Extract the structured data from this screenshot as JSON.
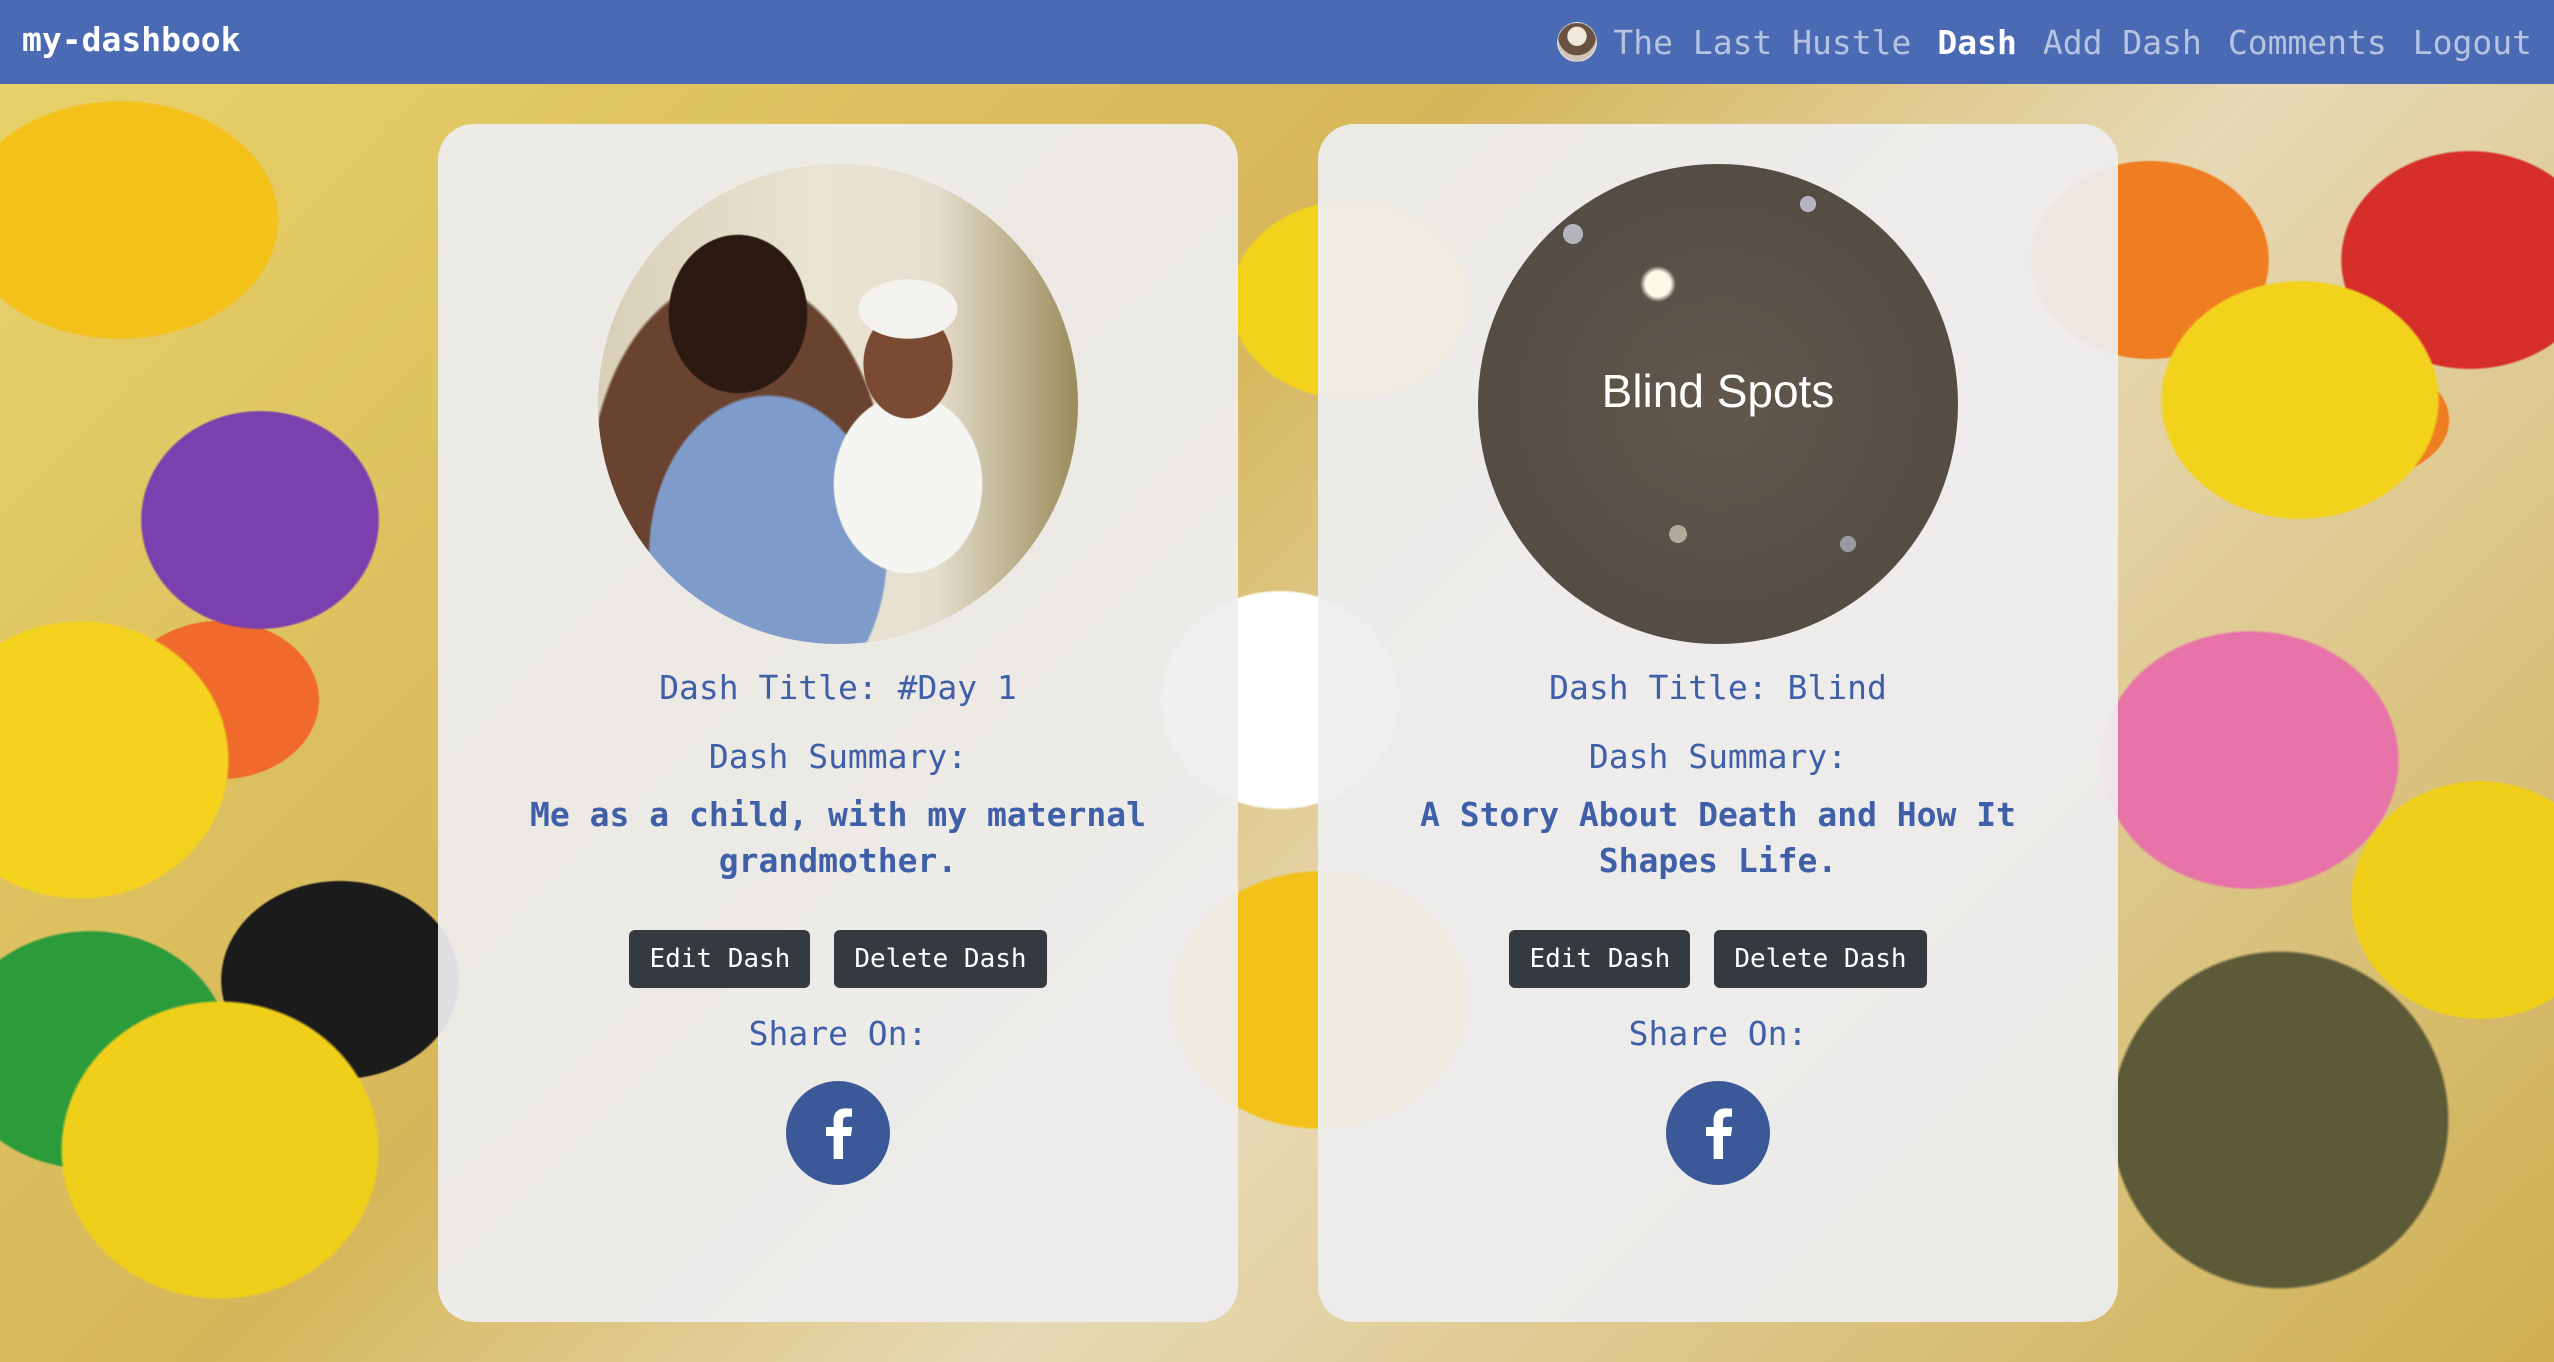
{
  "navbar": {
    "brand": "my-dashbook",
    "user_name": "The Last Hustle",
    "links": {
      "dash": "Dash",
      "add_dash": "Add Dash",
      "comments": "Comments",
      "logout": "Logout"
    },
    "active_link": "Dash"
  },
  "cards": [
    {
      "title": "Dash Title: #Day 1",
      "summary_label": "Dash Summary:",
      "summary": "Me as a child, with my maternal grandmother.",
      "image_text": "",
      "edit_label": "Edit Dash",
      "delete_label": "Delete Dash",
      "share_label": "Share On:",
      "share_icon": "facebook-icon"
    },
    {
      "title": "Dash Title: Blind",
      "summary_label": "Dash Summary:",
      "summary": "A Story About Death and How It Shapes Life.",
      "image_text": "Blind Spots",
      "edit_label": "Edit Dash",
      "delete_label": "Delete Dash",
      "share_label": "Share On:",
      "share_icon": "facebook-icon"
    }
  ],
  "colors": {
    "navbar": "#4a6ab3",
    "text_blue": "#3f5fa8",
    "button_dark": "#343a40",
    "facebook": "#3b5998"
  }
}
